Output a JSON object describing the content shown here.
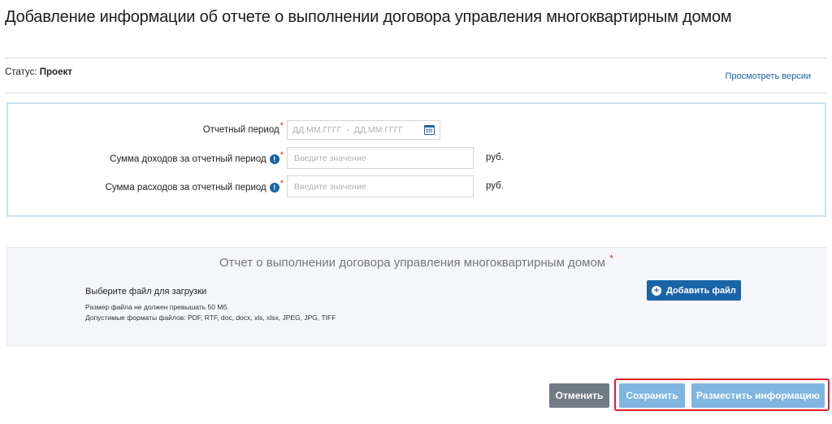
{
  "page": {
    "title": "Добавление информации об отчете о выполнении договора управления многоквартирным домом"
  },
  "status": {
    "label": "Статус:",
    "value": "Проект",
    "versions_link": "Просмотреть версии"
  },
  "form": {
    "period": {
      "label": "Отчетный период",
      "required_mark": "*",
      "from_placeholder": "ДД.ММ.ГГГГ",
      "separator": "-",
      "to_placeholder": "ДД.ММ.ГГГГ"
    },
    "income": {
      "label": "Сумма доходов за отчетный период",
      "required_mark": "*",
      "info": "!",
      "placeholder": "Введите значение",
      "unit": "руб."
    },
    "expenses": {
      "label": "Сумма расходов за отчетный период",
      "required_mark": "*",
      "info": "!",
      "placeholder": "Введите значение",
      "unit": "руб."
    }
  },
  "upload": {
    "title": "Отчет о выполнении договора управления многоквартирным домом",
    "required_mark": "*",
    "choose_label": "Выберите файл для загрузки",
    "size_hint": "Размер файла не должен превышать 50 Мб.",
    "formats_hint": "Допустимые форматы файлов: PDF, RTF, doc, docx, xls, xlsx, JPEG, JPG, TIFF",
    "add_button": "Добавить файл",
    "add_icon": "+"
  },
  "actions": {
    "cancel": "Отменить",
    "save": "Сохранить",
    "publish": "Разместить информацию"
  },
  "colors": {
    "accent": "#1a64a8",
    "button_light": "#7fb6e0",
    "button_cancel": "#707b86",
    "highlight": "#e31e24",
    "required": "#d12b2b"
  }
}
